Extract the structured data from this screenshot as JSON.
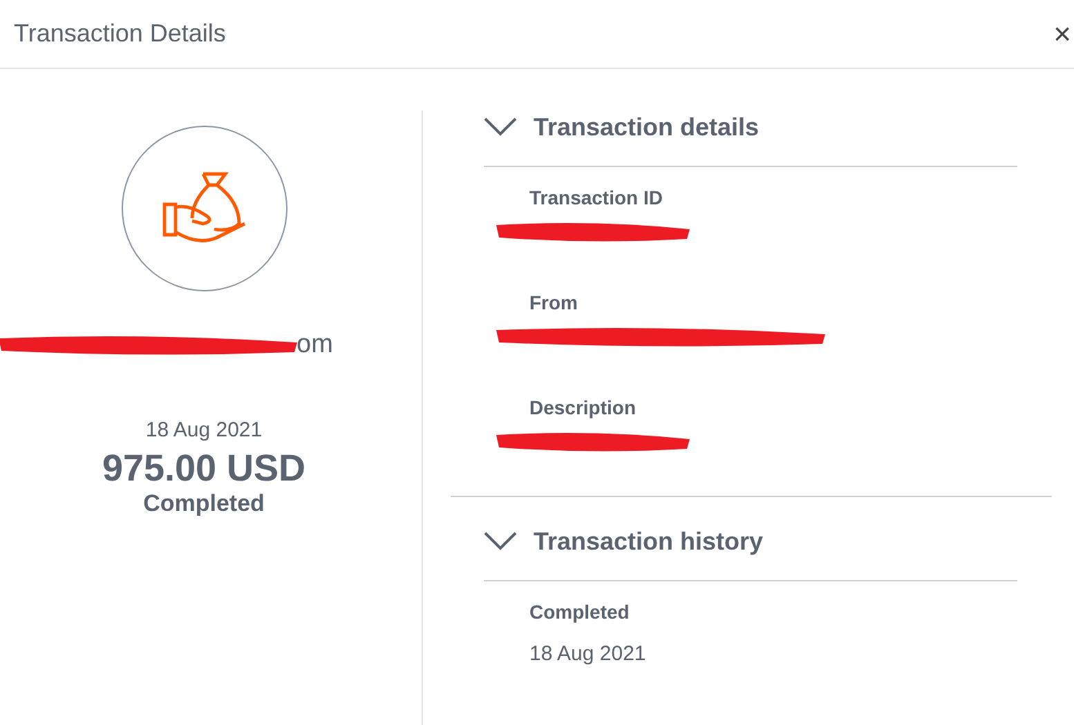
{
  "window": {
    "title": "Transaction Details",
    "close": "×"
  },
  "summary": {
    "email": "om",
    "date": "18 Aug 2021",
    "amount": "975.00 USD",
    "status": "Completed"
  },
  "sections": [
    {
      "title": "Transaction details",
      "expanded": true,
      "fields": [
        {
          "label": "Transaction ID",
          "redacted": true
        },
        {
          "label": "From",
          "redacted": true
        },
        {
          "label": "Description",
          "redacted": true
        }
      ]
    },
    {
      "title": "Transaction history",
      "expanded": true,
      "fields": [
        {
          "label": "Completed",
          "value": "18 Aug 2021"
        }
      ]
    }
  ]
}
